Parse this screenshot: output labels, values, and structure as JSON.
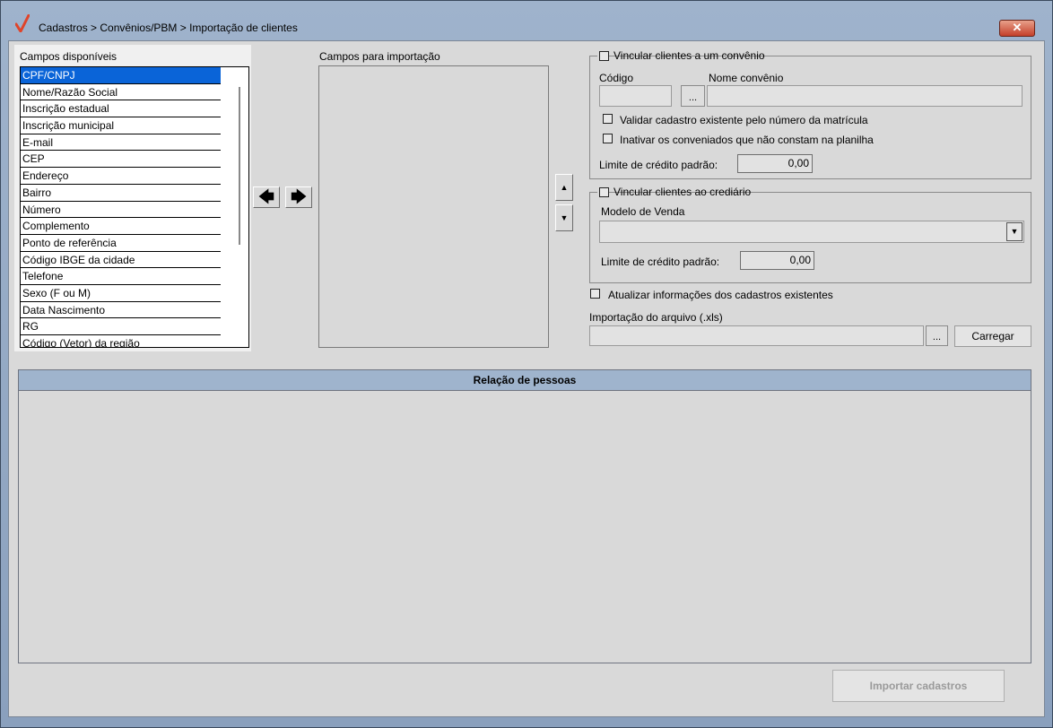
{
  "window": {
    "title": "Cadastros > Convênios/PBM > Importação de clientes",
    "close_label": "✕",
    "accent_color": "#e0442a"
  },
  "available": {
    "label": "Campos disponíveis",
    "items": [
      "CPF/CNPJ",
      "Nome/Razão Social",
      "Inscrição estadual",
      "Inscrição municipal",
      "E-mail",
      "CEP",
      "Endereço",
      "Bairro",
      "Número",
      "Complemento",
      "Ponto de referência",
      "Código IBGE da cidade",
      "Telefone",
      "Sexo (F ou M)",
      "Data Nascimento",
      "RG",
      "Código (Vetor) da região"
    ]
  },
  "transfer": {
    "left_icon": "arrow-left-icon",
    "right_icon": "arrow-right-icon",
    "left_label": "🡄",
    "right_label": "🡆"
  },
  "import_fields": {
    "label": "Campos para importação",
    "up_label": "▲",
    "down_label": "▼"
  },
  "convenio": {
    "checkbox_label": "Vincular clientes a um convênio",
    "codigo_label": "Código",
    "nome_label": "Nome convênio",
    "browse_label": "...",
    "validar_label": "Validar cadastro existente pelo número da matrícula",
    "inativar_label": "Inativar os conveniados que não constam na planilha",
    "limite_label": "Limite de crédito padrão:",
    "limite_value": "0,00"
  },
  "crediario": {
    "checkbox_label": "Vincular clientes ao crediário",
    "modelo_label": "Modelo de Venda",
    "dropdown_arrow": "▼",
    "limite_label": "Limite de crédito padrão:",
    "limite_value": "0,00"
  },
  "atualizar_label": "Atualizar informações dos cadastros existentes",
  "arquivo": {
    "label": "Importação do arquivo (.xls)",
    "browse_label": "...",
    "load_label": "Carregar"
  },
  "grid": {
    "title": "Relação de pessoas"
  },
  "import_button_label": "Importar cadastros"
}
